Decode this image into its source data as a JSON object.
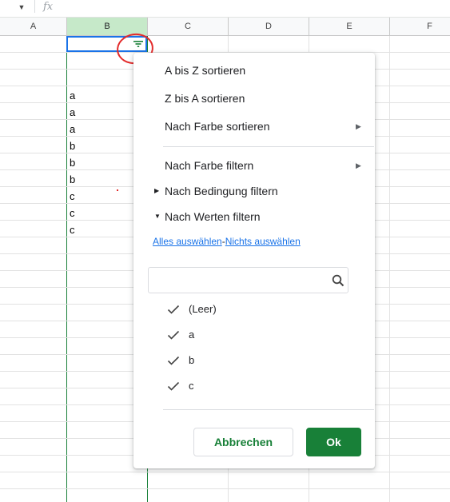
{
  "formula_bar": {
    "fx_label": "fx",
    "dropdown_icon": "triangle-down-icon"
  },
  "columns": [
    "A",
    "B",
    "C",
    "D",
    "E",
    "F"
  ],
  "selected_column": "B",
  "cells": [
    "a",
    "a",
    "a",
    "b",
    "b",
    "b",
    "c",
    "c",
    "c"
  ],
  "menu": {
    "sort_az": "A bis Z sortieren",
    "sort_za": "Z bis A sortieren",
    "sort_color": "Nach Farbe sortieren",
    "filter_color": "Nach Farbe filtern",
    "filter_condition": "Nach Bedingung filtern",
    "filter_values": "Nach Werten filtern",
    "select_all": "Alles auswählen",
    "separator": "-",
    "select_none": "Nichts auswählen",
    "search_placeholder": "",
    "values": [
      "(Leer)",
      "a",
      "b",
      "c"
    ],
    "cancel": "Abbrechen",
    "ok": "Ok"
  },
  "colors": {
    "accent_green": "#188038",
    "link_blue": "#1a73e8",
    "highlight_red": "#e32b2b"
  }
}
